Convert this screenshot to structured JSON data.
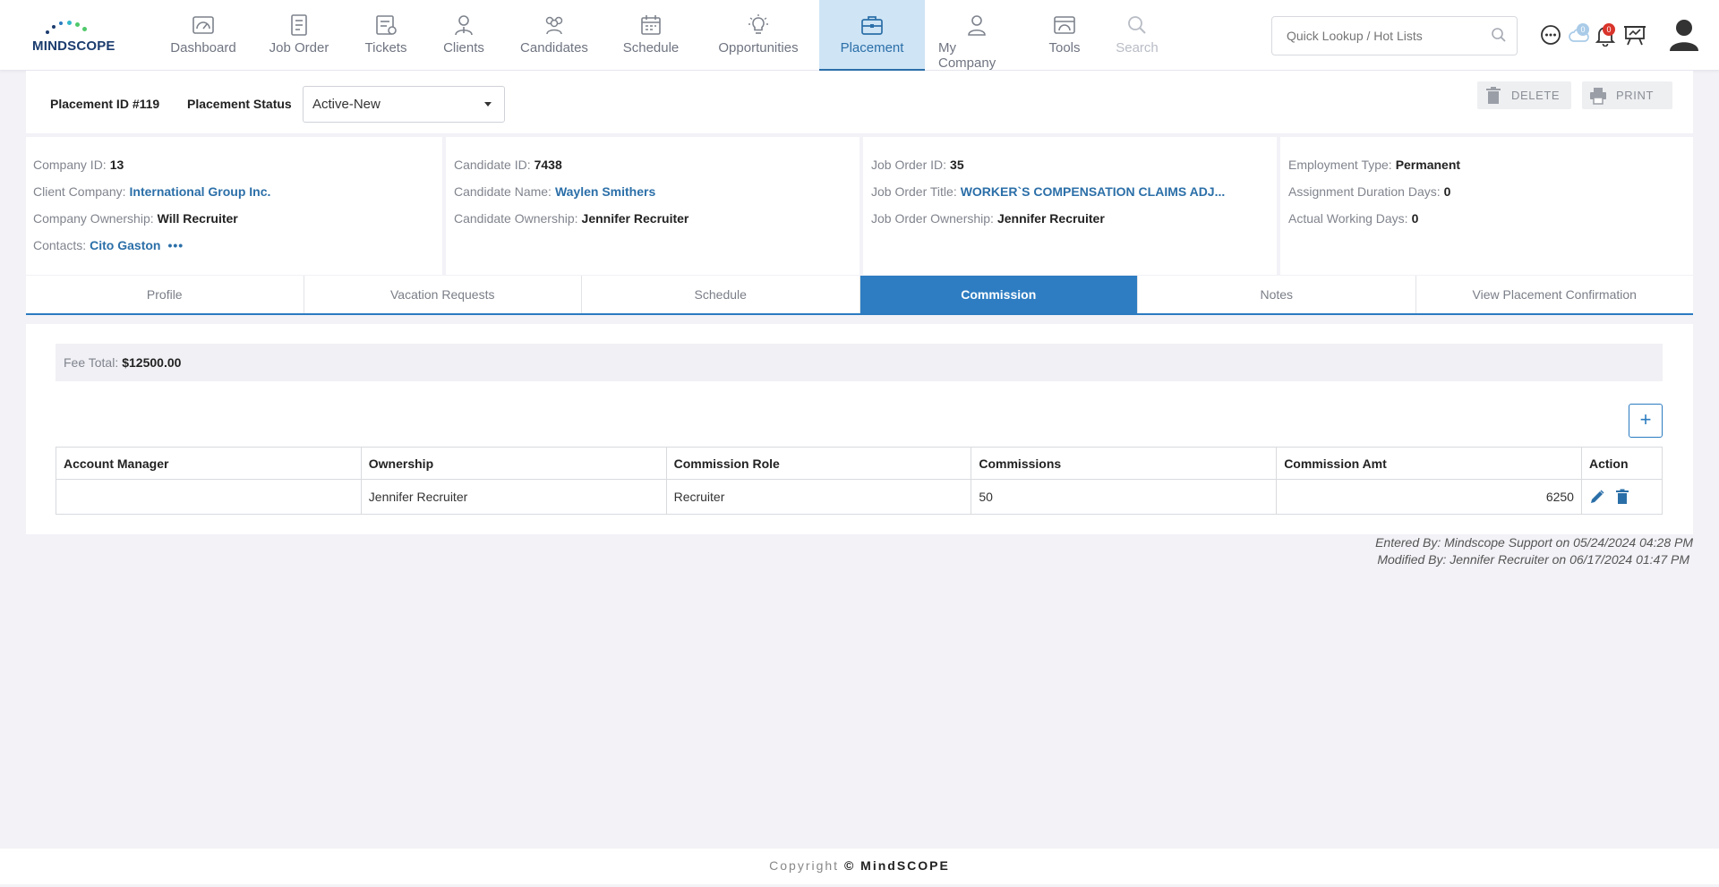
{
  "brand": {
    "logo_text": "MINDSCOPE",
    "logo_colors": [
      "#1b3c6e",
      "#2b7bc0",
      "#34b8c9",
      "#4fc96a"
    ]
  },
  "nav": {
    "items": [
      {
        "label": "Dashboard",
        "icon": "dashboard-icon"
      },
      {
        "label": "Job Order",
        "icon": "job-order-icon"
      },
      {
        "label": "Tickets",
        "icon": "tickets-icon"
      },
      {
        "label": "Clients",
        "icon": "clients-icon"
      },
      {
        "label": "Candidates",
        "icon": "candidates-icon"
      },
      {
        "label": "Schedule",
        "icon": "calendar-icon"
      },
      {
        "label": "Opportunities",
        "icon": "lightbulb-icon"
      },
      {
        "label": "Placement",
        "icon": "briefcase-icon",
        "active": true
      },
      {
        "label": "My Company",
        "icon": "user-icon"
      },
      {
        "label": "Tools",
        "icon": "tools-icon"
      },
      {
        "label": "Search",
        "icon": "search-icon"
      }
    ],
    "quick_lookup_placeholder": "Quick Lookup / Hot Lists",
    "cloud_count": "0",
    "bell_count": "0"
  },
  "header": {
    "placement_id": "Placement ID #119",
    "status_label": "Placement Status",
    "status_value": "Active-New",
    "delete_label": "DELETE",
    "print_label": "PRINT"
  },
  "company": {
    "id_label": "Company ID:",
    "id_value": "13",
    "client_label": "Client Company:",
    "client_value": "International Group Inc.",
    "ownership_label": "Company Ownership:",
    "ownership_value": "Will Recruiter",
    "contacts_label": "Contacts:",
    "contacts_value": "Cito Gaston",
    "more": "•••"
  },
  "candidate": {
    "id_label": "Candidate ID:",
    "id_value": "7438",
    "name_label": "Candidate Name:",
    "name_value": "Waylen Smithers",
    "ownership_label": "Candidate Ownership:",
    "ownership_value": "Jennifer Recruiter"
  },
  "job_order": {
    "id_label": "Job Order ID:",
    "id_value": "35",
    "title_label": "Job Order Title:",
    "title_value": "WORKER`S COMPENSATION CLAIMS ADJ...",
    "ownership_label": "Job Order Ownership:",
    "ownership_value": "Jennifer Recruiter"
  },
  "employment": {
    "type_label": "Employment Type:",
    "type_value": "Permanent",
    "duration_label": "Assignment Duration Days:",
    "duration_value": "0",
    "working_label": "Actual Working Days:",
    "working_value": "0"
  },
  "tabs": [
    "Profile",
    "Vacation Requests",
    "Schedule",
    "Commission",
    "Notes",
    "View Placement Confirmation"
  ],
  "active_tab": "Commission",
  "commission": {
    "fee_label": "Fee Total:",
    "fee_value": "$12500.00",
    "add_label": "+",
    "columns": [
      "Account Manager",
      "Ownership",
      "Commission Role",
      "Commissions",
      "Commission Amt",
      "Action"
    ],
    "rows": [
      {
        "account_manager": "",
        "ownership": "Jennifer Recruiter",
        "role": "Recruiter",
        "commissions": "50",
        "amount": "6250"
      }
    ]
  },
  "audit": {
    "entered": "Entered By: Mindscope Support on 05/24/2024 04:28 PM",
    "modified": "Modified By: Jennifer Recruiter on 06/17/2024 01:47 PM"
  },
  "footer": {
    "copyright_prefix": "Copyright",
    "copyright_brand": "© MindSCOPE"
  }
}
